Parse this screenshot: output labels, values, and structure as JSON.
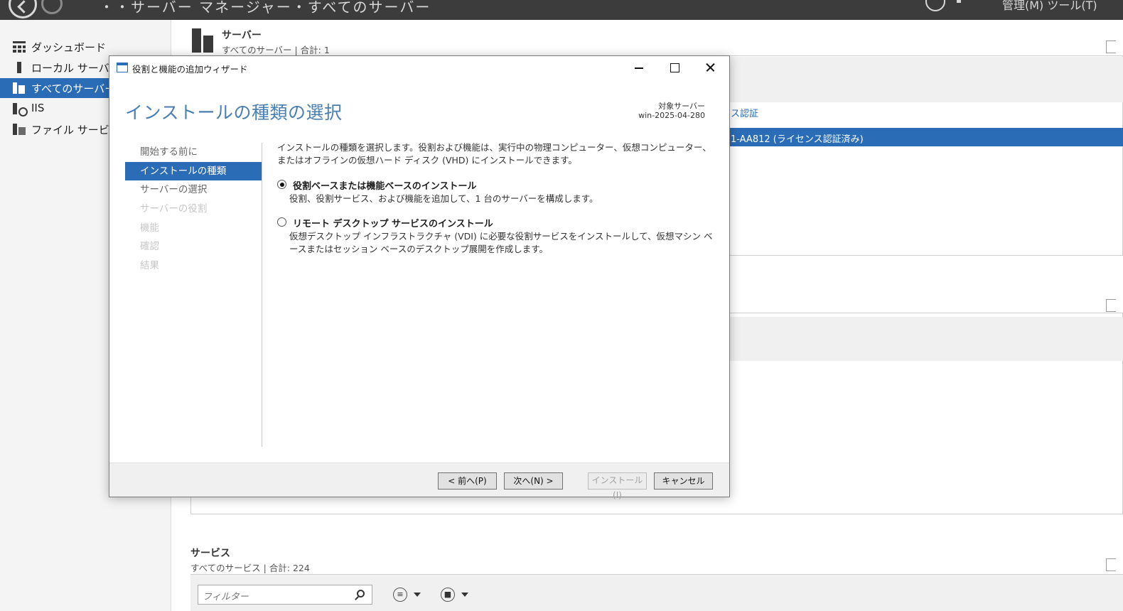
{
  "topbar": {
    "breadcrumb": "・・サーバー マネージャー・すべてのサーバー",
    "menu": "管理(M)  ツール(T)"
  },
  "sidebar": {
    "items": [
      {
        "label": "ダッシュボード",
        "icon": "dashboard-icon"
      },
      {
        "label": "ローカル サーバー",
        "icon": "local-server-icon"
      },
      {
        "label": "すべてのサーバー",
        "icon": "all-servers-icon",
        "active": true
      },
      {
        "label": "IIS",
        "icon": "iis-icon"
      },
      {
        "label": "ファイル サービスと記",
        "icon": "file-services-icon"
      }
    ]
  },
  "main": {
    "servers_title": "サーバー",
    "servers_sub": "すべてのサーバー | 合計: 1",
    "activation_link": "ス認証",
    "selected_row_text": "1-AA812 (ライセンス認証済み)",
    "services_title": "サービス",
    "services_sub": "すべてのサービス | 合計: 224",
    "filter_placeholder": "フィルター"
  },
  "dialog": {
    "title": "役割と機能の追加ウィザード",
    "heading": "インストールの種類の選択",
    "target_label": "対象サーバー",
    "target_value": "win-2025-04-280",
    "steps": [
      {
        "label": "開始する前に",
        "state": "enabled"
      },
      {
        "label": "インストールの種類",
        "state": "active"
      },
      {
        "label": "サーバーの選択",
        "state": "enabled"
      },
      {
        "label": "サーバーの役割",
        "state": "disabled"
      },
      {
        "label": "機能",
        "state": "disabled"
      },
      {
        "label": "確認",
        "state": "disabled"
      },
      {
        "label": "結果",
        "state": "disabled"
      }
    ],
    "description": "インストールの種類を選択します。役割および機能は、実行中の物理コンピューター、仮想コンピューター、またはオフラインの仮想ハード ディスク (VHD) にインストールできます。",
    "options": [
      {
        "label": "役割ベースまたは機能ベースのインストール",
        "desc": "役割、役割サービス、および機能を追加して、1 台のサーバーを構成します。",
        "checked": true
      },
      {
        "label": "リモート デスクトップ サービスのインストール",
        "desc": "仮想デスクトップ インフラストラクチャ (VDI) に必要な役割サービスをインストールして、仮想マシン ベースまたはセッション ベースのデスクトップ展開を作成します。",
        "checked": false
      }
    ],
    "buttons": {
      "previous": "< 前へ(P)",
      "next": "次へ(N) >",
      "install": "インストール(I)",
      "cancel": "キャンセル"
    }
  },
  "colors": {
    "accent": "#2a6cb6",
    "heading": "#4a7fb3",
    "titlebar_dark": "#3c3c3c"
  }
}
